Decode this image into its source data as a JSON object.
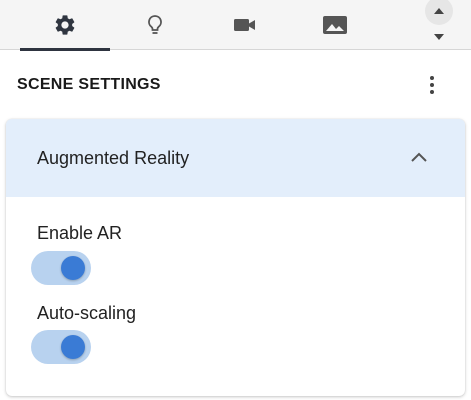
{
  "tabs": [
    {
      "icon": "gear-icon",
      "active": true
    },
    {
      "icon": "lightbulb-icon",
      "active": false
    },
    {
      "icon": "video-camera-icon",
      "active": false
    },
    {
      "icon": "image-icon",
      "active": false
    }
  ],
  "header": {
    "title": "SCENE SETTINGS"
  },
  "panel": {
    "title": "Augmented Reality",
    "expanded": true,
    "fields": [
      {
        "label": "Enable AR",
        "enabled": true
      },
      {
        "label": "Auto-scaling",
        "enabled": true
      }
    ]
  },
  "colors": {
    "accent": "#3a7bd5",
    "toggle_track": "#b8d2ef",
    "panel_header_bg": "#e3eefb",
    "active_tab_indicator": "#2e3440"
  }
}
